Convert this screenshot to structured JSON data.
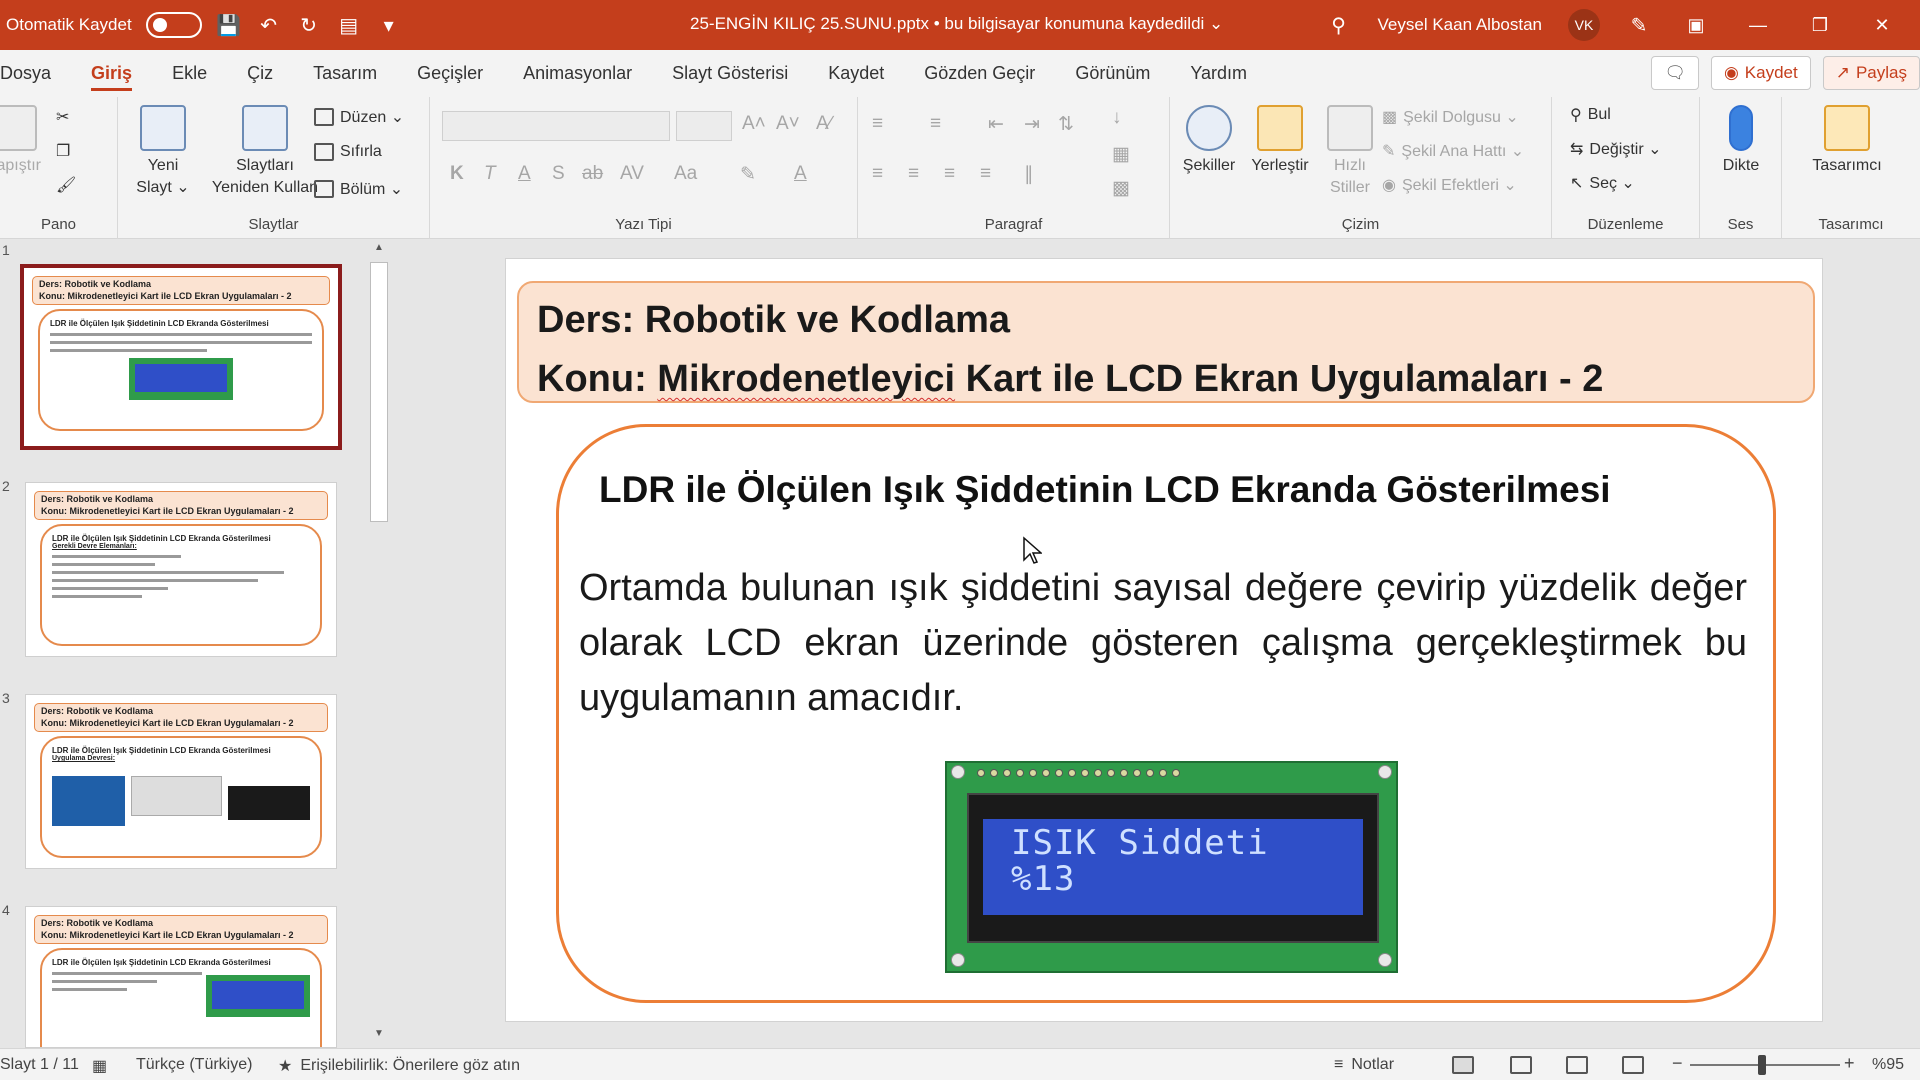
{
  "titlebar": {
    "autosave_label": "Otomatik Kaydet",
    "document_title": "25-ENGİN KILIÇ 25.SUNU.pptx  •  bu bilgisayar konumuna kaydedildi ⌄",
    "user_name": "Veysel Kaan Albostan",
    "user_initials": "VK"
  },
  "menu": {
    "tabs": [
      "Dosya",
      "Giriş",
      "Ekle",
      "Çiz",
      "Tasarım",
      "Geçişler",
      "Animasyonlar",
      "Slayt Gösterisi",
      "Kaydet",
      "Gözden Geçir",
      "Görünüm",
      "Yardım"
    ],
    "active_tab": "Giriş",
    "record_button": "Kaydet",
    "share_button": "Paylaş"
  },
  "ribbon": {
    "pano": {
      "label": "Pano",
      "paste": "Yapıştır"
    },
    "slaytlar": {
      "label": "Slaytlar",
      "new_slide_line1": "Yeni",
      "new_slide_line2": "Slayt ⌄",
      "reuse_line1": "Slaytları",
      "reuse_line2": "Yeniden Kullan",
      "layout": "Düzen ⌄",
      "reset": "Sıfırla",
      "section": "Bölüm ⌄"
    },
    "yazi_tipi": {
      "label": "Yazı Tipi",
      "bold": "K",
      "italic": "T",
      "underline": "A",
      "shadow": "S",
      "strike": "ab",
      "spacing": "AV",
      "case": "Aa",
      "grow": "A˄",
      "shrink": "A˅"
    },
    "paragraf": {
      "label": "Paragraf"
    },
    "cizim": {
      "label": "Çizim",
      "shapes": "Şekiller",
      "arrange": "Yerleştir",
      "quick_styles_line1": "Hızlı",
      "quick_styles_line2": "Stiller",
      "fill": "Şekil Dolgusu ⌄",
      "outline": "Şekil Ana Hattı ⌄",
      "effects": "Şekil Efektleri ⌄"
    },
    "duzenleme": {
      "label": "Düzenleme",
      "find": "Bul",
      "replace": "Değiştir ⌄",
      "select": "Seç ⌄"
    },
    "ses": {
      "label": "Ses",
      "dictate": "Dikte"
    },
    "tasarimci": {
      "label": "Tasarımcı",
      "designer": "Tasarımcı"
    }
  },
  "thumbnails": [
    {
      "num": "1",
      "head1": "Ders: Robotik ve Kodlama",
      "head2": "Konu: Mikrodenetleyici Kart ile LCD Ekran Uygulamaları - 2",
      "title": "LDR ile Ölçülen Işık Şiddetinin LCD Ekranda Gösterilmesi"
    },
    {
      "num": "2",
      "head1": "Ders: Robotik ve Kodlama",
      "head2": "Konu: Mikrodenetleyici Kart ile LCD Ekran Uygulamaları - 2",
      "title": "LDR ile Ölçülen Işık Şiddetinin LCD Ekranda Gösterilmesi",
      "subtitle": "Gerekli Devre Elemanları:"
    },
    {
      "num": "3",
      "head1": "Ders: Robotik ve Kodlama",
      "head2": "Konu: Mikrodenetleyici Kart ile LCD Ekran Uygulamaları - 2",
      "title": "LDR ile Ölçülen Işık Şiddetinin LCD Ekranda Gösterilmesi",
      "subtitle": "Uygulama Devresi:"
    },
    {
      "num": "4",
      "head1": "Ders: Robotik ve Kodlama",
      "head2": "Konu: Mikrodenetleyici Kart ile LCD Ekran Uygulamaları - 2",
      "title": "LDR ile Ölçülen Işık Şiddetinin LCD Ekranda Gösterilmesi"
    }
  ],
  "slide": {
    "header_line1": "Ders: Robotik ve Kodlama",
    "header_line2_prefix": "Konu: ",
    "header_line2_misspelled": "Mikrodenetleyici",
    "header_line2_rest": " Kart ile LCD Ekran Uygulamaları - 2",
    "content_title": "LDR ile Ölçülen Işık Şiddetinin LCD Ekranda Gösterilmesi",
    "content_text": "Ortamda bulunan ışık şiddetini sayısal değere çevirip yüzdelik değer olarak  LCD ekran üzerinde gösteren çalışma gerçekleştirmek bu uygulamanın amacıdır.",
    "lcd_line1": "ISIK Siddeti",
    "lcd_line2": "%13"
  },
  "statusbar": {
    "slide_counter": "Slayt 1 / 11",
    "language": "Türkçe (Türkiye)",
    "accessibility": "Erişilebilirlik: Önerilere göz atın",
    "notes": "Notlar",
    "zoom": "%95"
  },
  "colors": {
    "accent": "#c43e1c",
    "slide_header_fill": "#fbe3d2",
    "content_border": "#ec7e36",
    "lcd_board": "#2f9b4a",
    "lcd_screen": "#2f4fc8"
  }
}
